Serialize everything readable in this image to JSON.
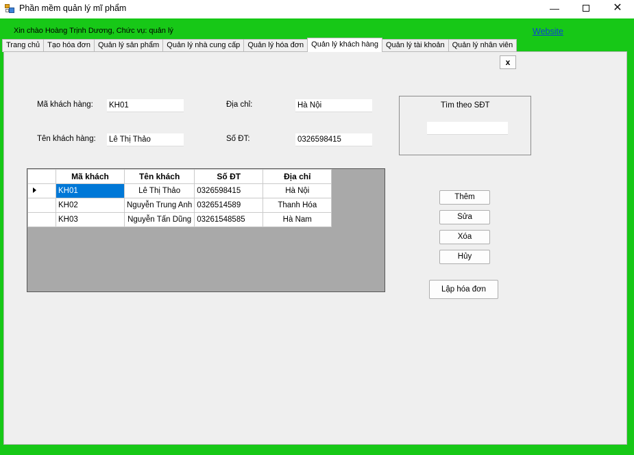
{
  "window": {
    "title": "Phần mềm quản lý mĩ phẩm",
    "close_symbol": "✕",
    "min_symbol": "—"
  },
  "header": {
    "greeting": "Xin chào Hoàng Trịnh Dương, Chức vụ: quản lý",
    "website_link": "Website"
  },
  "tabs": [
    {
      "label": "Trang chủ",
      "active": false
    },
    {
      "label": "Tạo hóa đơn",
      "active": false
    },
    {
      "label": "Quản lý sản phẩm",
      "active": false
    },
    {
      "label": "Quản lý nhà cung cấp",
      "active": false
    },
    {
      "label": "Quản lý hóa đơn",
      "active": false
    },
    {
      "label": "Quản lý khách hàng",
      "active": true
    },
    {
      "label": "Quản lý tài khoản",
      "active": false
    },
    {
      "label": "Quản lý nhân viên",
      "active": false
    }
  ],
  "form": {
    "close_label": "x",
    "customer_id_label": "Mã khách hàng:",
    "customer_id_value": "KH01",
    "customer_name_label": "Tên khách hàng:",
    "customer_name_value": "Lê Thị Thảo",
    "address_label": "Địa chỉ:",
    "address_value": "Hà Nội",
    "phone_label": "Số ĐT:",
    "phone_value": "0326598415"
  },
  "search": {
    "title": "Tìm theo SĐT",
    "value": ""
  },
  "grid": {
    "columns": [
      "Mã khách",
      "Tên khách",
      "Số ĐT",
      "Địa chỉ"
    ],
    "rows": [
      {
        "id": "KH01",
        "name": "Lê Thị Thảo",
        "phone": "0326598415",
        "address": "Hà Nội",
        "selected": true
      },
      {
        "id": "KH02",
        "name": "Nguyễn Trung Anh",
        "phone": "0326514589",
        "address": "Thanh Hóa",
        "selected": false
      },
      {
        "id": "KH03",
        "name": "Nguyễn Tấn Dũng",
        "phone": "03261548585",
        "address": "Hà Nam",
        "selected": false
      }
    ]
  },
  "actions": {
    "add_label": "Thêm",
    "edit_label": "Sửa",
    "delete_label": "Xóa",
    "cancel_label": "Hủy",
    "create_invoice_label": "Lập hóa đơn"
  },
  "colors": {
    "frame_green": "#17c817",
    "selection_blue": "#0078d7",
    "link_blue": "#0b3fd6"
  }
}
